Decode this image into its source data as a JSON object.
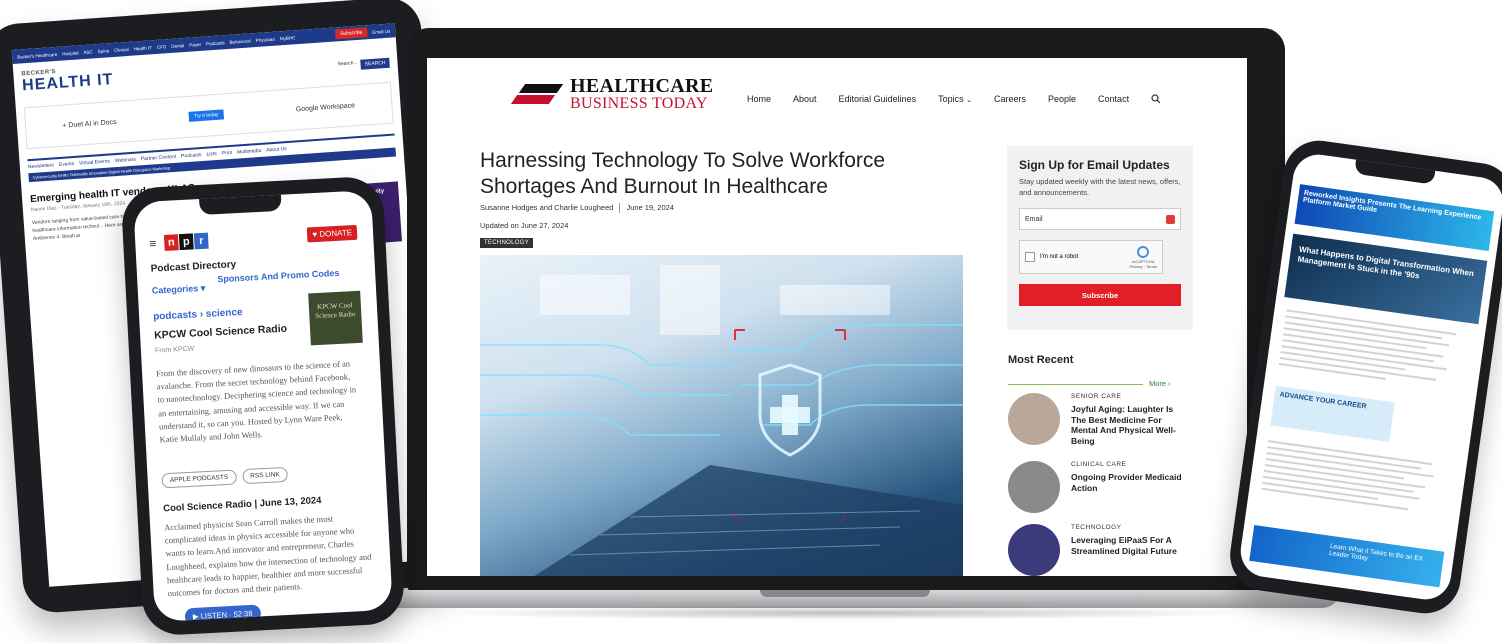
{
  "tablet": {
    "topnav": [
      "Becker's Healthcare",
      "Hospital",
      "ASC",
      "Spine",
      "Clinical",
      "Health IT",
      "CFO",
      "Dental",
      "Payer",
      "Podcasts",
      "Behavioral",
      "Physician",
      "MyBHC"
    ],
    "subscribe_label": "Subscribe",
    "email_label": "Email Us",
    "logo_small": "BECKER'S",
    "logo_big": "HEALTH IT",
    "search_placeholder": "Search...",
    "search_button": "SEARCH",
    "ad_left": "+ Duet AI in Docs",
    "ad_cta": "Try it today",
    "ad_right": "Google Workspace",
    "nav": [
      "Newsletters",
      "Events",
      "Virtual Events",
      "Webinars",
      "Partner Content",
      "Podcasts",
      "Lists",
      "Print",
      "Multimedia",
      "About Us"
    ],
    "subnav": "Cybersecurity  EHRs  Telehealth  Innovation  Digital Health  Disruptors  Marketing",
    "article_title": "Emerging health IT vendors: KLAS",
    "article_meta": "Naomi Diaz - Tuesday, January 16th, 2024",
    "body_text": "Vendors ranging from value-based care to patient engagement... KLAS asked organizations if it ... healthcare information technol... Here are the emerging vendors... Clinical tools: 1. Abridge 2. Accolly 3. Ambience 4. Binah.ai",
    "side_promo": "Power up your creativity with 20+ apps."
  },
  "laptop": {
    "logo_line1": "HEALTHCARE",
    "logo_line2": "BUSINESS TODAY",
    "nav": [
      "Home",
      "About",
      "Editorial Guidelines",
      "Topics",
      "Careers",
      "People",
      "Contact"
    ],
    "article_title": "Harnessing Technology To Solve Workforce Shortages And Burnout In Healthcare",
    "authors": "Susanne Hodges and Charlie Lougheed",
    "date": "June 19, 2024",
    "updated": "Updated on June 27, 2024",
    "tag": "TECHNOLOGY",
    "signup": {
      "title": "Sign Up for Email Updates",
      "text": "Stay updated weekly with the latest news, offers, and announcements.",
      "email_placeholder": "Email",
      "captcha_label": "I'm not a robot",
      "captcha_brand": "reCAPTCHA",
      "captcha_terms": "Privacy - Terms",
      "button": "Subscribe"
    },
    "recent_heading": "Most Recent",
    "more_label": "More ›",
    "recent": [
      {
        "category": "SENIOR CARE",
        "title": "Joyful Aging: Laughter Is The Best Medicine For Mental And Physical Well-Being",
        "thumb": "#b9a899"
      },
      {
        "category": "CLINICAL CARE",
        "title": "Ongoing Provider Medicaid Action",
        "thumb": "#8a8a8a"
      },
      {
        "category": "TECHNOLOGY",
        "title": "Leveraging EiPaaS For A Streamlined Digital Future",
        "thumb": "#3b3a7a"
      }
    ]
  },
  "phone_left": {
    "logo": [
      "n",
      "p",
      "r"
    ],
    "donate": "♥ DONATE",
    "directory": "Podcast Directory",
    "categories": "Categories ▾",
    "sponsors": "Sponsors And Promo Codes",
    "breadcrumb": "podcasts › science",
    "show_title": "KPCW Cool Science Radio",
    "from": "From KPCW",
    "art_text": "KPCW Cool Science Radio",
    "description": "From the discovery of new dinosaurs to the science of an avalanche. From the secret technology behind Facebook, to nanotechnology. Deciphering science and technology in an entertaining, amusing and accessible way. If we can understand it, so can you. Hosted by Lynn Ware Peek, Katie Mullaly and John Wells.",
    "apple_btn": "APPLE PODCASTS",
    "rss_btn": "RSS LINK",
    "episode_title": "Cool Science Radio | June 13, 2024",
    "episode_desc": "Acclaimed physicist Sean Carroll makes the most complicated ideas in physics accessible for anyone who wants to learn.And innovator and entrepreneur, Charles Loughheed, explains how the intersection of technology and healthcare leads to happier, healthier and more successful outcomes for doctors and their patients.",
    "listen": "▶ LISTEN · 52:38"
  },
  "phone_right": {
    "banner": "Reworked Insights Presents The Learning Experience Platform Market Guide",
    "hero_title": "What Happens to Digital Transformation When Management Is Stuck in the '90s",
    "advance": "ADVANCE YOUR CAREER",
    "cta": "Learn What it Takes to Be an EX Leader Today"
  },
  "colors": {
    "accent_red": "#c8102e",
    "subscribe_red": "#e21f26",
    "becker_blue": "#1e3a8a",
    "npr_blue": "#3266cc"
  }
}
